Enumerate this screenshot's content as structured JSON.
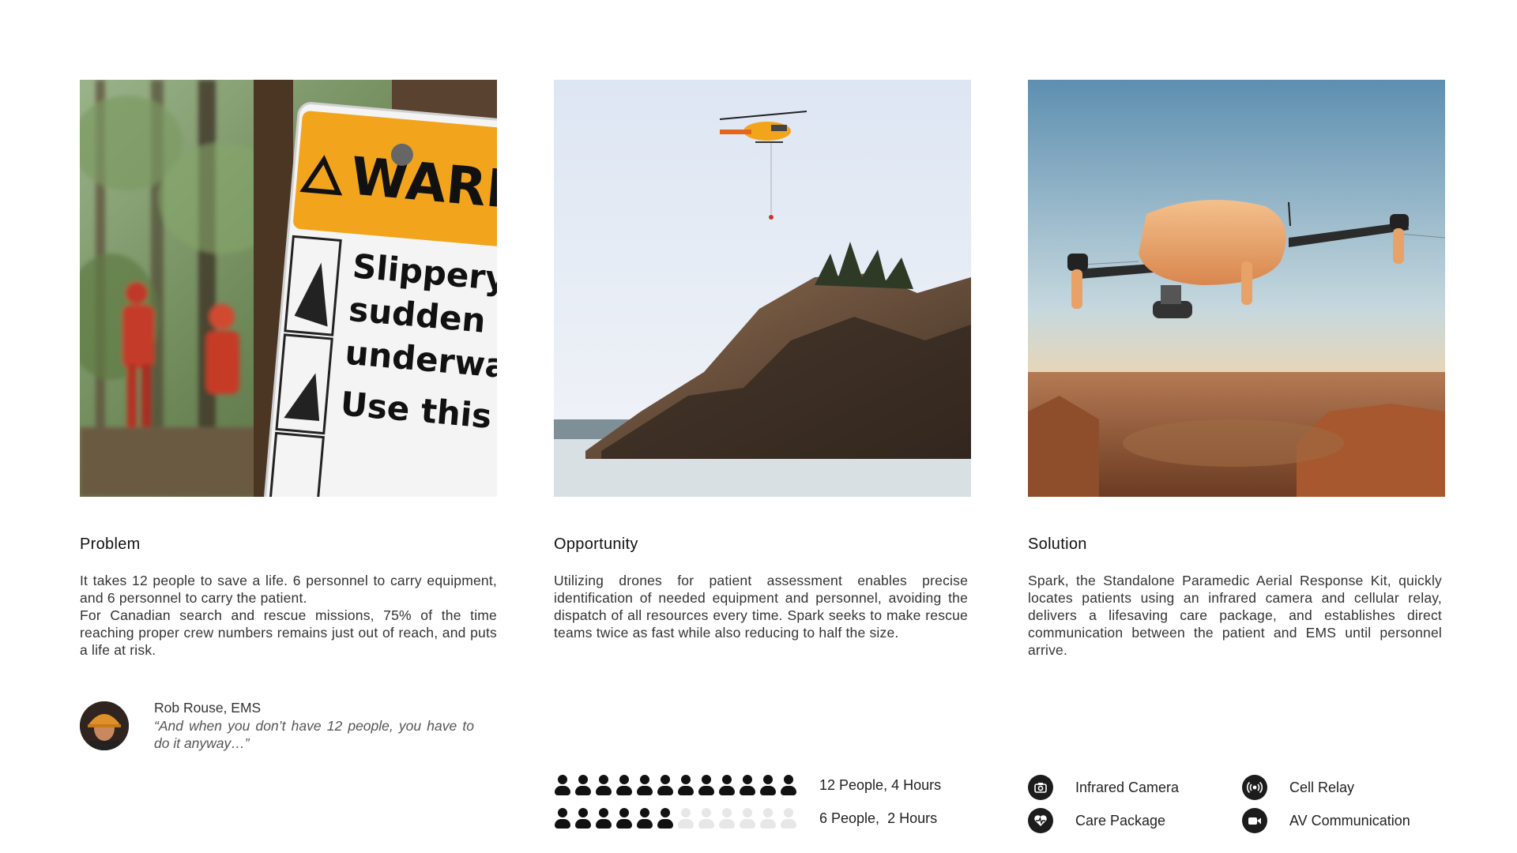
{
  "columns": [
    {
      "heading": "Problem",
      "body": [
        "It takes 12 people to save a life. 6 personnel to carry equipment, and 6 personnel to carry the patient.",
        "For Canadian search and rescue missions, 75% of the time reaching proper crew numbers remains just out of reach, and puts a life at risk."
      ],
      "image": "photo of rescue crew in red suits behind a yellow WARNING trail sign",
      "sign": {
        "title": "WARNIN",
        "lines": [
          "Slippery slopes,",
          "sudden drops and",
          "underwater hazard",
          "Use this a"
        ]
      },
      "testimonial": {
        "author": "Rob Rouse, EMS",
        "quote": "“And when you don’t have 12 people, you have to do it anyway…”"
      }
    },
    {
      "heading": "Opportunity",
      "body": [
        "Utilizing drones for patient assessment enables precise identification of needed equipment and personnel, avoiding the dispatch of all resources every time. Spark seeks to make rescue teams twice as fast while also reducing to half the size."
      ],
      "image": "photo of rescue helicopter over coastal rocky cliff",
      "people_rows": [
        {
          "label": "12 People, 4 Hours",
          "active": 12,
          "total": 12
        },
        {
          "label": "6 People,  2 Hours",
          "active": 6,
          "total": 12
        }
      ]
    },
    {
      "heading": "Solution",
      "body": [
        "Spark, the Standalone Paramedic Aerial Response Kit, quickly locates patients using an infrared camera and cellular relay, delivers a lifesaving care package, and establishes direct communication between the patient and EMS until personnel arrive."
      ],
      "image": "render of orange drone flying over canyon",
      "features": [
        {
          "label": "Infrared Camera",
          "icon": "camera-icon"
        },
        {
          "label": "Cell Relay",
          "icon": "broadcast-icon"
        },
        {
          "label": "Care Package",
          "icon": "heart-pulse-icon"
        },
        {
          "label": "AV Communication",
          "icon": "video-camera-icon"
        }
      ]
    }
  ],
  "colors": {
    "warning_yellow": "#f2a51c",
    "drone_orange": "#e8a268",
    "person_active": "#111111",
    "person_inactive": "#e7e7e7"
  }
}
